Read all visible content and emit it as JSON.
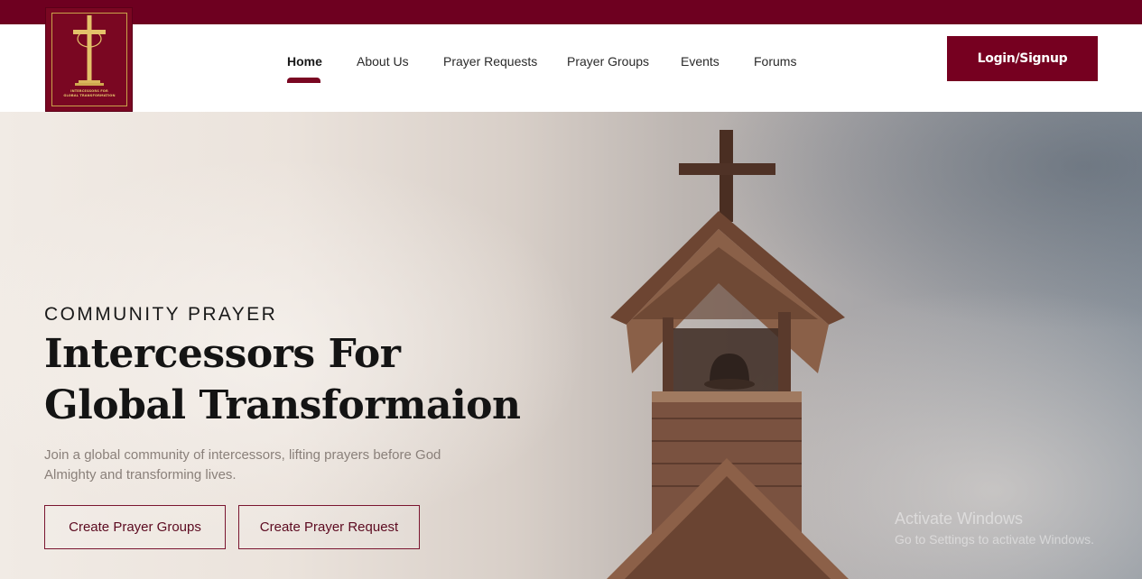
{
  "logo": {
    "line1": "INTERCESSORS FOR",
    "line2": "GLOBAL TRANSFORMATION",
    "bg_color": "#7a0722",
    "accent_color": "#c9a24a"
  },
  "nav": {
    "items": [
      {
        "label": "Home",
        "active": true
      },
      {
        "label": "About Us",
        "active": false
      },
      {
        "label": "Prayer Requests",
        "active": false
      },
      {
        "label": "Prayer Groups",
        "active": false
      },
      {
        "label": "Events",
        "active": false
      },
      {
        "label": "Forums",
        "active": false
      }
    ],
    "login_label": "Login/Signup"
  },
  "hero": {
    "eyebrow": "COMMUNITY PRAYER",
    "title_line1": "Intercessors For",
    "title_line2": "Global Transformaion",
    "description": "Join a global community of intercessors, lifting prayers before God Almighty and transforming lives.",
    "buttons": {
      "create_groups": "Create Prayer Groups",
      "create_request": "Create Prayer Request"
    }
  },
  "watermark": {
    "line1": "Activate Windows",
    "line2": "Go to Settings to activate Windows."
  },
  "colors": {
    "brand": "#760020",
    "topbar": "#6e0020"
  }
}
